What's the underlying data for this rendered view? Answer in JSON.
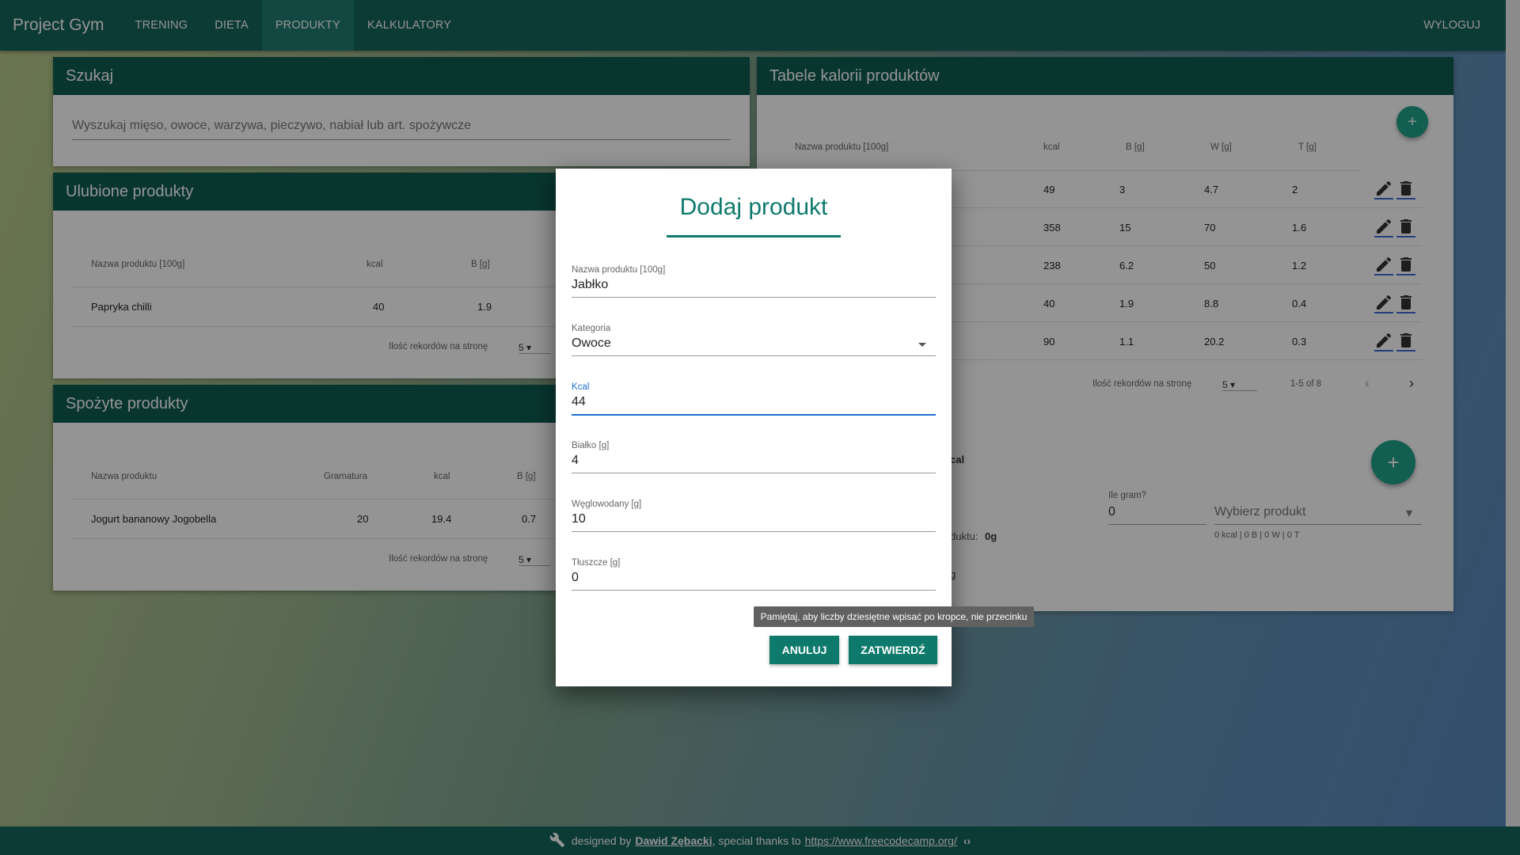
{
  "nav": {
    "brand": "Project Gym",
    "items": [
      "TRENING",
      "DIETA",
      "PRODUKTY",
      "KALKULATORY"
    ],
    "active_index": 2,
    "logout": "WYLOGUJ"
  },
  "search_card": {
    "title": "Szukaj",
    "placeholder": "Wyszukaj mięso, owoce, warzywa, pieczywo, nabiał lub art. spożywcze"
  },
  "favorites_card": {
    "title": "Ulubione produkty",
    "columns": [
      "Nazwa produktu [100g]",
      "kcal",
      "B [g]"
    ],
    "rows": [
      [
        "Papryka chilli",
        "40",
        "1.9"
      ]
    ],
    "pager_label": "Ilość rekordów na stronę",
    "pager_value": "5"
  },
  "eaten_card": {
    "title": "Spożyte produkty",
    "columns": [
      "Nazwa produktu",
      "Gramatura",
      "kcal",
      "B [g]"
    ],
    "rows": [
      [
        "Jogurt bananowy Jogobella",
        "20",
        "19.4",
        "0.7"
      ]
    ],
    "pager_label": "Ilość rekordów na stronę",
    "pager_value": "5"
  },
  "calories_card": {
    "title": "Tabele kalorii produktów",
    "columns": [
      "Nazwa produktu [100g]",
      "kcal",
      "B [g]",
      "W [g]",
      "T [g]"
    ],
    "rows": [
      [
        "49",
        "3",
        "4.7",
        "2"
      ],
      [
        "358",
        "15",
        "70",
        "1.6"
      ],
      [
        "238",
        "6.2",
        "50",
        "1.2"
      ],
      [
        "40",
        "1.9",
        "8.8",
        "0.4"
      ],
      [
        "90",
        "1.1",
        "20.2",
        "0.3"
      ]
    ],
    "pager_label": "Ilość rekordów na stronę",
    "pager_value": "5",
    "pager_range": "1-5 of 8",
    "calc": {
      "kcal_partial": "cal",
      "grams_label": "Ile gram?",
      "grams_value": "0",
      "product_placeholder": "Wybierz produkt",
      "summary": "0 kcal | 0 B | 0 W | 0 T",
      "partial_label": "duktu:",
      "partial_value": "0g",
      "partial_g": "g"
    }
  },
  "dialog": {
    "title": "Dodaj produkt",
    "fields": {
      "name": {
        "label": "Nazwa produktu [100g]",
        "value": "Jabłko"
      },
      "category": {
        "label": "Kategoria",
        "value": "Owoce"
      },
      "kcal": {
        "label": "Kcal",
        "value": "44"
      },
      "protein": {
        "label": "Białko [g]",
        "value": "4"
      },
      "carbs": {
        "label": "Węglowodany [g]",
        "value": "10"
      },
      "fat": {
        "label": "Tłuszcze [g]",
        "value": "0"
      }
    },
    "cancel": "ANULUJ",
    "confirm": "ZATWIERDŹ",
    "tooltip": "Pamiętaj, aby liczby dziesiętne wpisać po kropce, nie przecinku"
  },
  "footer": {
    "prefix": "designed by",
    "author": "Dawid Zębacki",
    "middle": ", special thanks to",
    "link": "https://www.freecodecamp.org/"
  },
  "colors": {
    "topbar": "#16645a",
    "card_header": "#0e5d51",
    "accent": "#0e7a6c",
    "fab": "#1fa38a",
    "focus": "#1e6fd1"
  }
}
